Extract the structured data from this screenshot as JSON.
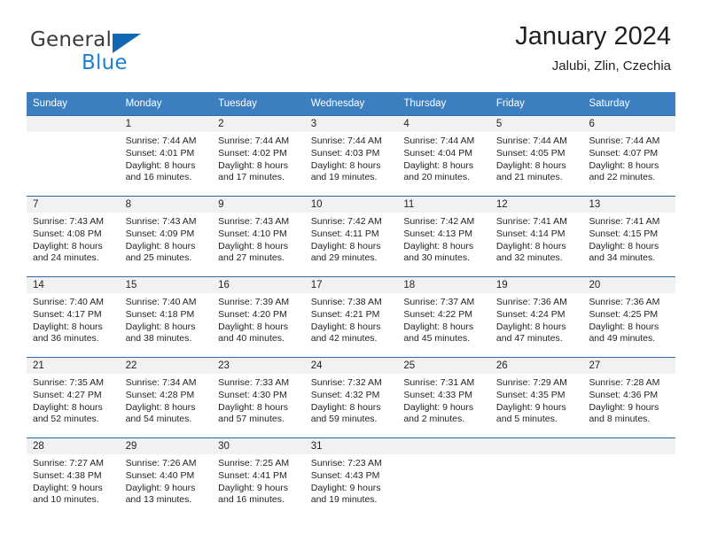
{
  "brand": {
    "name_top": "General",
    "name_bottom": "Blue",
    "accent_color": "#1267b2",
    "blue_text_color": "#1b7fd4"
  },
  "header": {
    "title": "January 2024",
    "subtitle": "Jalubi, Zlin, Czechia"
  },
  "theme": {
    "header_row_bg": "#3c7fc1",
    "row_divider": "#2b6ca8",
    "day_band_bg": "#f1f1f1",
    "text": "#231f20"
  },
  "weekdays": [
    "Sunday",
    "Monday",
    "Tuesday",
    "Wednesday",
    "Thursday",
    "Friday",
    "Saturday"
  ],
  "weeks": [
    [
      {
        "day": "",
        "sunrise": "",
        "sunset": "",
        "daylight_line1": "",
        "daylight_line2": ""
      },
      {
        "day": "1",
        "sunrise": "Sunrise: 7:44 AM",
        "sunset": "Sunset: 4:01 PM",
        "daylight_line1": "Daylight: 8 hours",
        "daylight_line2": "and 16 minutes."
      },
      {
        "day": "2",
        "sunrise": "Sunrise: 7:44 AM",
        "sunset": "Sunset: 4:02 PM",
        "daylight_line1": "Daylight: 8 hours",
        "daylight_line2": "and 17 minutes."
      },
      {
        "day": "3",
        "sunrise": "Sunrise: 7:44 AM",
        "sunset": "Sunset: 4:03 PM",
        "daylight_line1": "Daylight: 8 hours",
        "daylight_line2": "and 19 minutes."
      },
      {
        "day": "4",
        "sunrise": "Sunrise: 7:44 AM",
        "sunset": "Sunset: 4:04 PM",
        "daylight_line1": "Daylight: 8 hours",
        "daylight_line2": "and 20 minutes."
      },
      {
        "day": "5",
        "sunrise": "Sunrise: 7:44 AM",
        "sunset": "Sunset: 4:05 PM",
        "daylight_line1": "Daylight: 8 hours",
        "daylight_line2": "and 21 minutes."
      },
      {
        "day": "6",
        "sunrise": "Sunrise: 7:44 AM",
        "sunset": "Sunset: 4:07 PM",
        "daylight_line1": "Daylight: 8 hours",
        "daylight_line2": "and 22 minutes."
      }
    ],
    [
      {
        "day": "7",
        "sunrise": "Sunrise: 7:43 AM",
        "sunset": "Sunset: 4:08 PM",
        "daylight_line1": "Daylight: 8 hours",
        "daylight_line2": "and 24 minutes."
      },
      {
        "day": "8",
        "sunrise": "Sunrise: 7:43 AM",
        "sunset": "Sunset: 4:09 PM",
        "daylight_line1": "Daylight: 8 hours",
        "daylight_line2": "and 25 minutes."
      },
      {
        "day": "9",
        "sunrise": "Sunrise: 7:43 AM",
        "sunset": "Sunset: 4:10 PM",
        "daylight_line1": "Daylight: 8 hours",
        "daylight_line2": "and 27 minutes."
      },
      {
        "day": "10",
        "sunrise": "Sunrise: 7:42 AM",
        "sunset": "Sunset: 4:11 PM",
        "daylight_line1": "Daylight: 8 hours",
        "daylight_line2": "and 29 minutes."
      },
      {
        "day": "11",
        "sunrise": "Sunrise: 7:42 AM",
        "sunset": "Sunset: 4:13 PM",
        "daylight_line1": "Daylight: 8 hours",
        "daylight_line2": "and 30 minutes."
      },
      {
        "day": "12",
        "sunrise": "Sunrise: 7:41 AM",
        "sunset": "Sunset: 4:14 PM",
        "daylight_line1": "Daylight: 8 hours",
        "daylight_line2": "and 32 minutes."
      },
      {
        "day": "13",
        "sunrise": "Sunrise: 7:41 AM",
        "sunset": "Sunset: 4:15 PM",
        "daylight_line1": "Daylight: 8 hours",
        "daylight_line2": "and 34 minutes."
      }
    ],
    [
      {
        "day": "14",
        "sunrise": "Sunrise: 7:40 AM",
        "sunset": "Sunset: 4:17 PM",
        "daylight_line1": "Daylight: 8 hours",
        "daylight_line2": "and 36 minutes."
      },
      {
        "day": "15",
        "sunrise": "Sunrise: 7:40 AM",
        "sunset": "Sunset: 4:18 PM",
        "daylight_line1": "Daylight: 8 hours",
        "daylight_line2": "and 38 minutes."
      },
      {
        "day": "16",
        "sunrise": "Sunrise: 7:39 AM",
        "sunset": "Sunset: 4:20 PM",
        "daylight_line1": "Daylight: 8 hours",
        "daylight_line2": "and 40 minutes."
      },
      {
        "day": "17",
        "sunrise": "Sunrise: 7:38 AM",
        "sunset": "Sunset: 4:21 PM",
        "daylight_line1": "Daylight: 8 hours",
        "daylight_line2": "and 42 minutes."
      },
      {
        "day": "18",
        "sunrise": "Sunrise: 7:37 AM",
        "sunset": "Sunset: 4:22 PM",
        "daylight_line1": "Daylight: 8 hours",
        "daylight_line2": "and 45 minutes."
      },
      {
        "day": "19",
        "sunrise": "Sunrise: 7:36 AM",
        "sunset": "Sunset: 4:24 PM",
        "daylight_line1": "Daylight: 8 hours",
        "daylight_line2": "and 47 minutes."
      },
      {
        "day": "20",
        "sunrise": "Sunrise: 7:36 AM",
        "sunset": "Sunset: 4:25 PM",
        "daylight_line1": "Daylight: 8 hours",
        "daylight_line2": "and 49 minutes."
      }
    ],
    [
      {
        "day": "21",
        "sunrise": "Sunrise: 7:35 AM",
        "sunset": "Sunset: 4:27 PM",
        "daylight_line1": "Daylight: 8 hours",
        "daylight_line2": "and 52 minutes."
      },
      {
        "day": "22",
        "sunrise": "Sunrise: 7:34 AM",
        "sunset": "Sunset: 4:28 PM",
        "daylight_line1": "Daylight: 8 hours",
        "daylight_line2": "and 54 minutes."
      },
      {
        "day": "23",
        "sunrise": "Sunrise: 7:33 AM",
        "sunset": "Sunset: 4:30 PM",
        "daylight_line1": "Daylight: 8 hours",
        "daylight_line2": "and 57 minutes."
      },
      {
        "day": "24",
        "sunrise": "Sunrise: 7:32 AM",
        "sunset": "Sunset: 4:32 PM",
        "daylight_line1": "Daylight: 8 hours",
        "daylight_line2": "and 59 minutes."
      },
      {
        "day": "25",
        "sunrise": "Sunrise: 7:31 AM",
        "sunset": "Sunset: 4:33 PM",
        "daylight_line1": "Daylight: 9 hours",
        "daylight_line2": "and 2 minutes."
      },
      {
        "day": "26",
        "sunrise": "Sunrise: 7:29 AM",
        "sunset": "Sunset: 4:35 PM",
        "daylight_line1": "Daylight: 9 hours",
        "daylight_line2": "and 5 minutes."
      },
      {
        "day": "27",
        "sunrise": "Sunrise: 7:28 AM",
        "sunset": "Sunset: 4:36 PM",
        "daylight_line1": "Daylight: 9 hours",
        "daylight_line2": "and 8 minutes."
      }
    ],
    [
      {
        "day": "28",
        "sunrise": "Sunrise: 7:27 AM",
        "sunset": "Sunset: 4:38 PM",
        "daylight_line1": "Daylight: 9 hours",
        "daylight_line2": "and 10 minutes."
      },
      {
        "day": "29",
        "sunrise": "Sunrise: 7:26 AM",
        "sunset": "Sunset: 4:40 PM",
        "daylight_line1": "Daylight: 9 hours",
        "daylight_line2": "and 13 minutes."
      },
      {
        "day": "30",
        "sunrise": "Sunrise: 7:25 AM",
        "sunset": "Sunset: 4:41 PM",
        "daylight_line1": "Daylight: 9 hours",
        "daylight_line2": "and 16 minutes."
      },
      {
        "day": "31",
        "sunrise": "Sunrise: 7:23 AM",
        "sunset": "Sunset: 4:43 PM",
        "daylight_line1": "Daylight: 9 hours",
        "daylight_line2": "and 19 minutes."
      },
      {
        "day": "",
        "sunrise": "",
        "sunset": "",
        "daylight_line1": "",
        "daylight_line2": ""
      },
      {
        "day": "",
        "sunrise": "",
        "sunset": "",
        "daylight_line1": "",
        "daylight_line2": ""
      },
      {
        "day": "",
        "sunrise": "",
        "sunset": "",
        "daylight_line1": "",
        "daylight_line2": ""
      }
    ]
  ]
}
